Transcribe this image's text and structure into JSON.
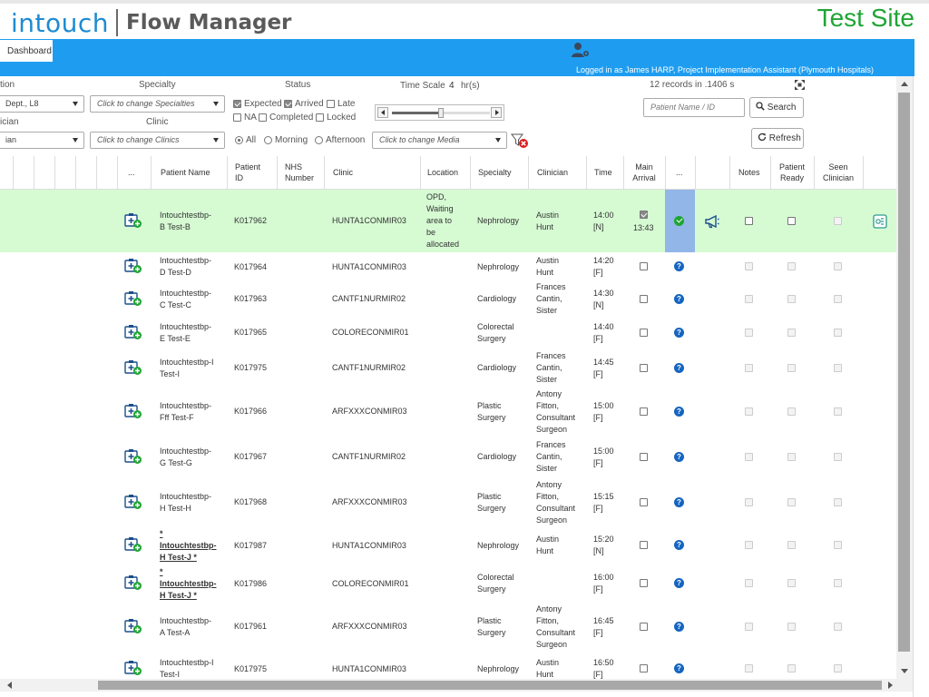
{
  "header": {
    "brand_main": "intouch",
    "brand_sub": "Flow Manager",
    "site_label": "Test Site"
  },
  "nav": {
    "tab_dashboard": "Dashboard",
    "logged_in": "Logged in as James HARP, Project Implementation Assistant (Plymouth Hospitals)"
  },
  "filters": {
    "location_label": "tion",
    "location_value": "Dept., L8",
    "clinician_label": "ician",
    "clinician_value": "ian",
    "specialty_label": "Specialty",
    "specialty_placeholder": "Click to change Specialties",
    "clinic_label": "Clinic",
    "clinic_placeholder": "Click to change Clinics",
    "status_label": "Status",
    "status_options": [
      {
        "label": "Expected",
        "checked": true
      },
      {
        "label": "Arrived",
        "checked": true
      },
      {
        "label": "Late",
        "checked": false
      },
      {
        "label": "NA",
        "checked": false
      },
      {
        "label": "Completed",
        "checked": false
      },
      {
        "label": "Locked",
        "checked": false
      }
    ],
    "session_options": [
      {
        "label": "All",
        "checked": true
      },
      {
        "label": "Morning",
        "checked": false
      },
      {
        "label": "Afternoon",
        "checked": false
      }
    ],
    "time_scale_label": "Time Scale",
    "time_scale_value": "4",
    "time_scale_unit": "hr(s)",
    "time_scale_level": 0.5,
    "media_placeholder": "Click to change Media",
    "records_info": "12 records in .1406 s",
    "patient_search_placeholder": "Patient Name / ID",
    "search_button": "Search",
    "refresh_button": "Refresh"
  },
  "table": {
    "headers": {
      "dots1": "...",
      "patient_name": "Patient Name",
      "patient_id": "Patient ID",
      "nhs": "NHS Number",
      "clinic": "Clinic",
      "location": "Location",
      "specialty": "Specialty",
      "clinician": "Clinician",
      "time": "Time",
      "main_arrival": "Main Arrival",
      "dots2": "...",
      "notes": "Notes",
      "patient_ready": "Patient Ready",
      "seen_clinician": "Seen Clinician"
    },
    "rows": [
      {
        "name": "Intouchtestbp-\nB Test-B",
        "id": "K017962",
        "clinic": "HUNTA1CONMIR03",
        "location": "OPD,\nWaiting\narea to\nbe\nallocated",
        "specialty": "Nephrology",
        "clinician": "Austin\nHunt",
        "time": "14:00\n[N]",
        "arrival_checked": true,
        "arrival_time": "13:43",
        "status": "arrived",
        "highlight": true,
        "bold": false
      },
      {
        "name": "Intouchtestbp-\nD Test-D",
        "id": "K017964",
        "clinic": "HUNTA1CONMIR03",
        "location": "",
        "specialty": "Nephrology",
        "clinician": "Austin\nHunt",
        "time": "14:20\n[F]",
        "arrival_checked": false,
        "arrival_time": "",
        "status": "unknown",
        "highlight": false,
        "bold": false
      },
      {
        "name": "Intouchtestbp-\nC Test-C",
        "id": "K017963",
        "clinic": "CANTF1NURMIR02",
        "location": "",
        "specialty": "Cardiology",
        "clinician": "Frances\nCantin,\nSister",
        "time": "14:30\n[N]",
        "arrival_checked": false,
        "arrival_time": "",
        "status": "unknown",
        "highlight": false,
        "bold": false
      },
      {
        "name": "Intouchtestbp-\nE Test-E",
        "id": "K017965",
        "clinic": "COLORECONMIR01",
        "location": "",
        "specialty": "Colorectal\nSurgery",
        "clinician": "",
        "time": "14:40\n[F]",
        "arrival_checked": false,
        "arrival_time": "",
        "status": "unknown",
        "highlight": false,
        "bold": false
      },
      {
        "name": "Intouchtestbp-I\nTest-I",
        "id": "K017975",
        "clinic": "CANTF1NURMIR02",
        "location": "",
        "specialty": "Cardiology",
        "clinician": "Frances\nCantin,\nSister",
        "time": "14:45\n[F]",
        "arrival_checked": false,
        "arrival_time": "",
        "status": "unknown",
        "highlight": false,
        "bold": false
      },
      {
        "name": "Intouchtestbp-\nFff Test-F",
        "id": "K017966",
        "clinic": "ARFXXXCONMIR03",
        "location": "",
        "specialty": "Plastic\nSurgery",
        "clinician": "Antony\nFitton,\nConsultant\nSurgeon",
        "time": "15:00\n[F]",
        "arrival_checked": false,
        "arrival_time": "",
        "status": "unknown",
        "highlight": false,
        "bold": false
      },
      {
        "name": "Intouchtestbp-\nG Test-G",
        "id": "K017967",
        "clinic": "CANTF1NURMIR02",
        "location": "",
        "specialty": "Cardiology",
        "clinician": "Frances\nCantin,\nSister",
        "time": "15:00\n[F]",
        "arrival_checked": false,
        "arrival_time": "",
        "status": "unknown",
        "highlight": false,
        "bold": false
      },
      {
        "name": "Intouchtestbp-\nH Test-H",
        "id": "K017968",
        "clinic": "ARFXXXCONMIR03",
        "location": "",
        "specialty": "Plastic\nSurgery",
        "clinician": "Antony\nFitton,\nConsultant\nSurgeon",
        "time": "15:15\n[F]",
        "arrival_checked": false,
        "arrival_time": "",
        "status": "unknown",
        "highlight": false,
        "bold": false
      },
      {
        "name": "*\nIntouchtestbp-\nH Test-J *",
        "id": "K017987",
        "clinic": "HUNTA1CONMIR03",
        "location": "",
        "specialty": "Nephrology",
        "clinician": "Austin\nHunt",
        "time": "15:20\n[N]",
        "arrival_checked": false,
        "arrival_time": "",
        "status": "unknown",
        "highlight": false,
        "bold": true
      },
      {
        "name": "*\nIntouchtestbp-\nH Test-J *",
        "id": "K017986",
        "clinic": "COLORECONMIR01",
        "location": "",
        "specialty": "Colorectal\nSurgery",
        "clinician": "",
        "time": "16:00\n[F]",
        "arrival_checked": false,
        "arrival_time": "",
        "status": "unknown",
        "highlight": false,
        "bold": true
      },
      {
        "name": "Intouchtestbp-\nA Test-A",
        "id": "K017961",
        "clinic": "ARFXXXCONMIR03",
        "location": "",
        "specialty": "Plastic\nSurgery",
        "clinician": "Antony\nFitton,\nConsultant\nSurgeon",
        "time": "16:45\n[F]",
        "arrival_checked": false,
        "arrival_time": "",
        "status": "unknown",
        "highlight": false,
        "bold": false
      },
      {
        "name": "Intouchtestbp-I\nTest-I",
        "id": "K017975",
        "clinic": "HUNTA1CONMIR03",
        "location": "",
        "specialty": "Nephrology",
        "clinician": "Austin\nHunt",
        "time": "16:50\n[F]",
        "arrival_checked": false,
        "arrival_time": "",
        "status": "unknown",
        "highlight": false,
        "bold": false
      }
    ]
  },
  "colors": {
    "brand_blue": "#1e8bd2",
    "nav_blue": "#1e9df0",
    "test_site_green": "#1fa534",
    "row_highlight": "#d6fbd3",
    "status_column": "#92b6e8",
    "help_icon": "#1565c0"
  }
}
